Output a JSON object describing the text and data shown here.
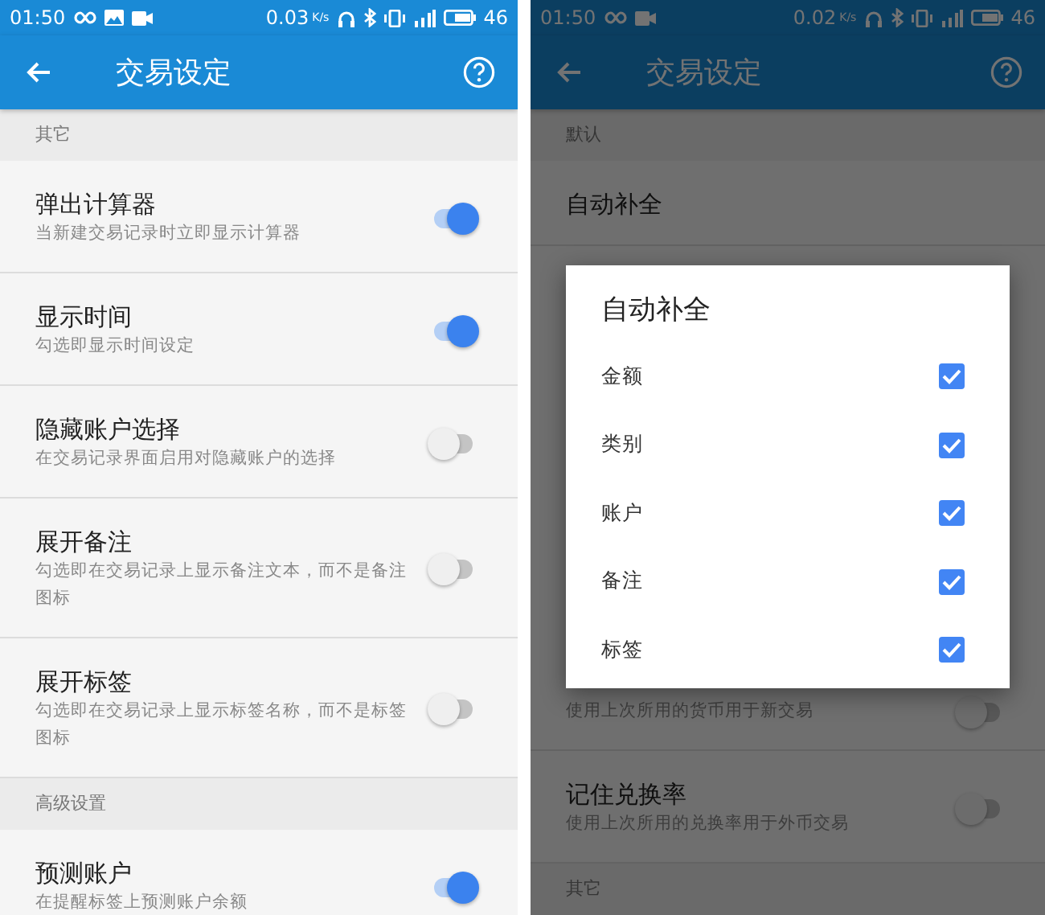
{
  "screens": [
    {
      "status_bar": {
        "time": "01:50",
        "notifications": [
          {
            "kind": "link"
          },
          {
            "kind": "image"
          },
          {
            "kind": "video"
          }
        ],
        "speed": "0.03",
        "speed_unit": "K/s",
        "battery": "46"
      },
      "app_bar": {
        "title": "交易设定"
      },
      "sections": [
        {
          "header": "其它",
          "items": [
            {
              "title": "弹出计算器",
              "subtitle": "当新建交易记录时立即显示计算器",
              "on": true
            },
            {
              "title": "显示时间",
              "subtitle": "勾选即显示时间设定",
              "on": true
            },
            {
              "title": "隐藏账户选择",
              "subtitle": "在交易记录界面启用对隐藏账户的选择",
              "on": false
            },
            {
              "title": "展开备注",
              "subtitle": "勾选即在交易记录上显示备注文本，而不是备注图标",
              "on": false
            },
            {
              "title": "展开标签",
              "subtitle": "勾选即在交易记录上显示标签名称，而不是标签图标",
              "on": false
            }
          ]
        },
        {
          "header": "高级设置",
          "items": [
            {
              "title": "预测账户",
              "subtitle": "在提醒标签上预测账户余额",
              "on": true
            }
          ]
        }
      ]
    },
    {
      "status_bar": {
        "time": "01:50",
        "notifications": [
          {
            "kind": "link"
          },
          {
            "kind": "video"
          }
        ],
        "speed": "0.02",
        "speed_unit": "K/s",
        "battery": "46"
      },
      "app_bar": {
        "title": "交易设定"
      },
      "sections": [
        {
          "header": "默认",
          "items": [
            {
              "title": "自动补全"
            },
            {
              "subtitle": "使用上次所用的货币用于新交易",
              "on": false
            },
            {
              "title": "记住兑换率",
              "subtitle": "使用上次所用的兑换率用于外币交易",
              "on": false
            }
          ]
        },
        {
          "header": "其它"
        }
      ],
      "dialog": {
        "title": "自动补全",
        "options": [
          {
            "label": "金额",
            "checked": true
          },
          {
            "label": "类别",
            "checked": true
          },
          {
            "label": "账户",
            "checked": true
          },
          {
            "label": "备注",
            "checked": true
          },
          {
            "label": "标签",
            "checked": true
          }
        ]
      }
    }
  ]
}
